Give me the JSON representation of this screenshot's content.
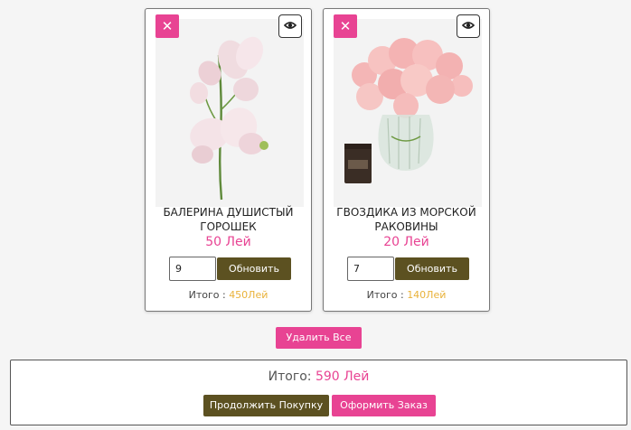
{
  "cart": {
    "items": [
      {
        "title": "БАЛЕРИНА ДУШИСТЫЙ ГОРОШЕК",
        "price": "50 Лей",
        "quantity": "9",
        "update_label": "Обновить",
        "subtotal_label": "Итого :",
        "subtotal_value": "450Лей",
        "remove_icon": "close-icon",
        "view_icon": "eye-icon"
      },
      {
        "title": "ГВОЗДИКА ИЗ МОРСКОЙ РАКОВИНЫ",
        "price": "20 Лей",
        "quantity": "7",
        "update_label": "Обновить",
        "subtotal_label": "Итого :",
        "subtotal_value": "140Лей",
        "remove_icon": "close-icon",
        "view_icon": "eye-icon"
      }
    ],
    "delete_all_label": "Удалить Все"
  },
  "summary": {
    "total_label": "Итого:",
    "total_value": "590 Лей",
    "continue_label": "Продолжить Покупку",
    "checkout_label": "Оформить Заказ"
  },
  "colors": {
    "accent_pink": "#e84393",
    "olive": "#5c5121",
    "subtotal_gold": "#e9b23a"
  }
}
